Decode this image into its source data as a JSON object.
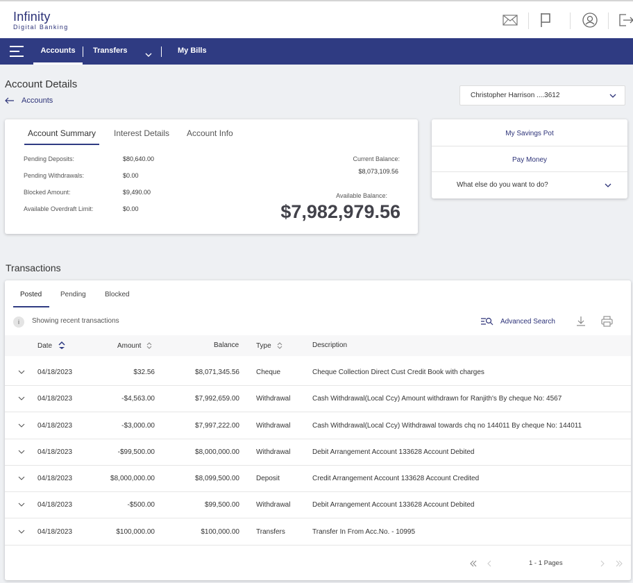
{
  "app": {
    "logo_title": "Infinity",
    "logo_subtitle": "Digital Banking",
    "brand_color": "#2f3b82"
  },
  "header_icons": [
    "mail-icon",
    "flag-icon",
    "user-icon",
    "logout-icon"
  ],
  "nav": {
    "items": [
      {
        "label": "Accounts",
        "active": true
      },
      {
        "label": "Transfers",
        "active": false,
        "has_dropdown": true
      },
      {
        "label": "My Bills",
        "active": false
      }
    ]
  },
  "page": {
    "title": "Account Details",
    "breadcrumb": "Accounts"
  },
  "account_selector": {
    "value": "Christopher Harrison ....3612"
  },
  "summary": {
    "tabs": [
      "Account Summary",
      "Interest Details",
      "Account Info"
    ],
    "active_tab": "Account Summary",
    "rows": [
      {
        "label": "Pending Deposits:",
        "value": "$80,640.00"
      },
      {
        "label": "Pending Withdrawals:",
        "value": "$0.00"
      },
      {
        "label": "Blocked Amount:",
        "value": "$9,490.00"
      },
      {
        "label": "Available Overdraft Limit:",
        "value": "$0.00"
      }
    ],
    "current_balance_label": "Current Balance:",
    "current_balance": "$8,073,109.56",
    "available_balance_label": "Available Balance:",
    "available_balance": "$7,982,979.56"
  },
  "actions": {
    "links": [
      "My Savings Pot",
      "Pay Money"
    ],
    "dropdown": "What else do you want to do?"
  },
  "transactions": {
    "title": "Transactions",
    "tabs": [
      "Posted",
      "Pending",
      "Blocked"
    ],
    "active_tab": "Posted",
    "info": "Showing recent transactions",
    "advanced_search": "Advanced Search",
    "columns": [
      "Date",
      "Amount",
      "Balance",
      "Type",
      "Description"
    ],
    "rows": [
      {
        "date": "04/18/2023",
        "amount": "$32.56",
        "balance": "$8,071,345.56",
        "type": "Cheque",
        "description": "Cheque Collection Direct Cust Credit Book with charges"
      },
      {
        "date": "04/18/2023",
        "amount": "-$4,563.00",
        "balance": "$7,992,659.00",
        "type": "Withdrawal",
        "description": "Cash Withdrawal(Local Ccy) Amount withdrawn for Ranjith's By cheque No: 4567"
      },
      {
        "date": "04/18/2023",
        "amount": "-$3,000.00",
        "balance": "$7,997,222.00",
        "type": "Withdrawal",
        "description": "Cash Withdrawal(Local Ccy) Withdrawal towards chq no 144011 By cheque No: 144011"
      },
      {
        "date": "04/18/2023",
        "amount": "-$99,500.00",
        "balance": "$8,000,000.00",
        "type": "Withdrawal",
        "description": "Debit Arrangement Account 133628 Account Debited"
      },
      {
        "date": "04/18/2023",
        "amount": "$8,000,000.00",
        "balance": "$8,099,500.00",
        "type": "Deposit",
        "description": "Credit Arrangement Account 133628 Account Credited"
      },
      {
        "date": "04/18/2023",
        "amount": "-$500.00",
        "balance": "$99,500.00",
        "type": "Withdrawal",
        "description": "Debit Arrangement Account 133628 Account Debited"
      },
      {
        "date": "04/18/2023",
        "amount": "$100,000.00",
        "balance": "$100,000.00",
        "type": "Transfers",
        "description": "Transfer In From Acc.No. - 10995"
      }
    ],
    "pagination": "1 - 1 Pages"
  }
}
